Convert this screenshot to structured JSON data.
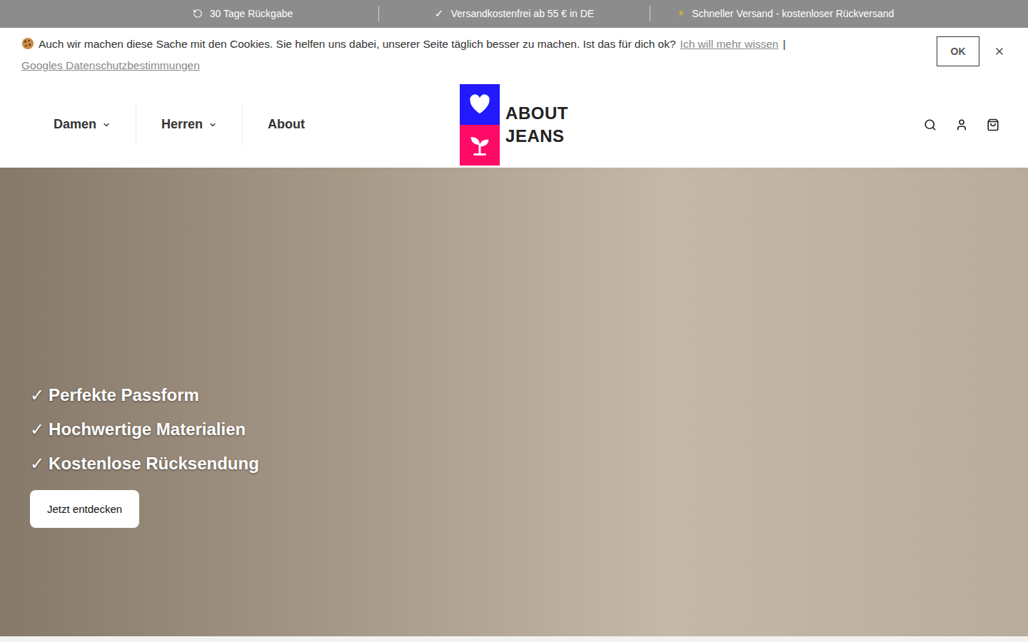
{
  "promo_bar": [
    {
      "kind": "icon",
      "symbol": "",
      "text": "30 Tage Rückgabe"
    },
    {
      "kind": "glyph",
      "symbol": "✓",
      "text": "Versandkostenfrei ab 55 € in DE"
    },
    {
      "kind": "glyph",
      "symbol": "⚡",
      "text": "Schneller Versand - kostenloser Rückversand"
    }
  ],
  "cookie_banner": {
    "text": "Auch wir machen diese Sache mit den Cookies. Sie helfen uns dabei, unserer Seite täglich besser zu machen. Ist das für dich ok?",
    "link": "Ich will mehr wissen",
    "separator": "|",
    "privacy_link": "Googles Datenschutzbestimmungen",
    "accept": "OK"
  },
  "nav": [
    {
      "label": "Damen",
      "has_dropdown": true
    },
    {
      "label": "Herren",
      "has_dropdown": true
    },
    {
      "label": "About",
      "has_dropdown": false
    }
  ],
  "logo": {
    "line1": "ABOUT",
    "line2": "JEANS"
  },
  "hero": {
    "bullets": [
      {
        "symbol": "✓",
        "text": "Perfekte Passform"
      },
      {
        "symbol": "✓",
        "text": "Hochwertige Materialien"
      },
      {
        "symbol": "✓",
        "text": "Kostenlose Rücksendung"
      }
    ],
    "button": "Jetzt entdecken"
  }
}
